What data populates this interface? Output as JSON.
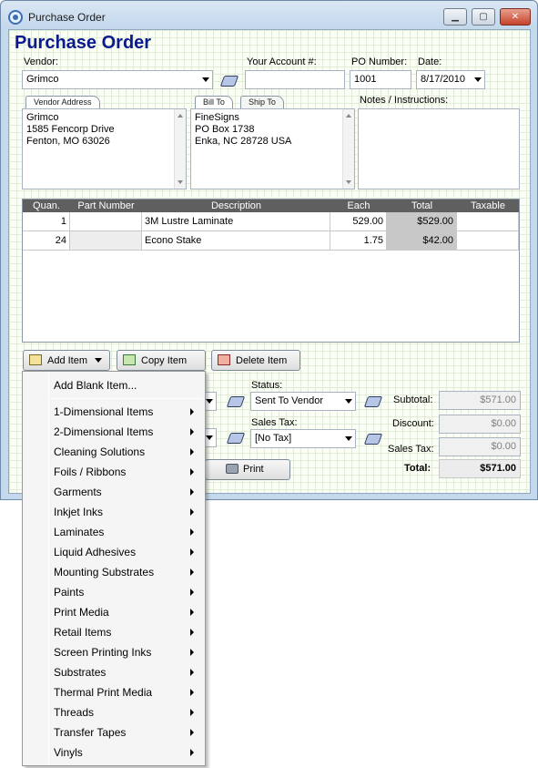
{
  "window": {
    "title": "Purchase Order",
    "minimize": "▁",
    "maximize": "▢",
    "close": "✕"
  },
  "header": {
    "title": "Purchase Order"
  },
  "vendor": {
    "label": "Vendor:",
    "value": "Grimco"
  },
  "account": {
    "label": "Your Account #:",
    "value": ""
  },
  "po": {
    "label": "PO Number:",
    "value": "1001"
  },
  "date": {
    "label": "Date:",
    "value": "8/17/2010"
  },
  "vendor_address": {
    "tab": "Vendor Address",
    "lines": [
      "Grimco",
      "1585 Fencorp Drive",
      "Fenton, MO  63026"
    ]
  },
  "ship_tabs": {
    "bill_to": "Bill To",
    "ship_to": "Ship To"
  },
  "bill_to": {
    "lines": [
      "FineSigns",
      "PO Box 1738",
      "Enka, NC 28728 USA"
    ]
  },
  "notes": {
    "label": "Notes / Instructions:",
    "value": ""
  },
  "grid": {
    "columns": [
      "Quan.",
      "Part Number",
      "Description",
      "Each",
      "Total",
      "Taxable"
    ],
    "rows": [
      {
        "quan": "1",
        "part": "",
        "description": "3M Lustre Laminate",
        "each": "529.00",
        "total": "$529.00",
        "taxable": ""
      },
      {
        "quan": "24",
        "part": "",
        "description": "Econo Stake",
        "each": "1.75",
        "total": "$42.00",
        "taxable": ""
      }
    ]
  },
  "buttons": {
    "add_item": "Add Item",
    "copy_item": "Copy Item",
    "delete_item": "Delete Item",
    "print": "Print"
  },
  "status": {
    "label": "Status:",
    "value": "Sent To Vendor"
  },
  "sales_tax_select": {
    "label": "Sales Tax:",
    "value": "[No Tax]"
  },
  "totals": {
    "subtotal_label": "Subtotal:",
    "subtotal": "$571.00",
    "discount_label": "Discount:",
    "discount": "$0.00",
    "sales_tax_label": "Sales Tax:",
    "sales_tax": "$0.00",
    "total_label": "Total:",
    "total": "$571.00"
  },
  "menu": {
    "blank": "Add Blank Item...",
    "items": [
      "1-Dimensional Items",
      "2-Dimensional Items",
      "Cleaning Solutions",
      "Foils / Ribbons",
      "Garments",
      "Inkjet Inks",
      "Laminates",
      "Liquid Adhesives",
      "Mounting Substrates",
      "Paints",
      "Print Media",
      "Retail Items",
      "Screen Printing Inks",
      "Substrates",
      "Thermal Print Media",
      "Threads",
      "Transfer Tapes",
      "Vinyls"
    ]
  },
  "icons": [
    "app-icon",
    "book-icon",
    "add-item-icon",
    "copy-item-icon",
    "delete-item-icon",
    "printer-icon",
    "submenu-arrow-icon"
  ]
}
